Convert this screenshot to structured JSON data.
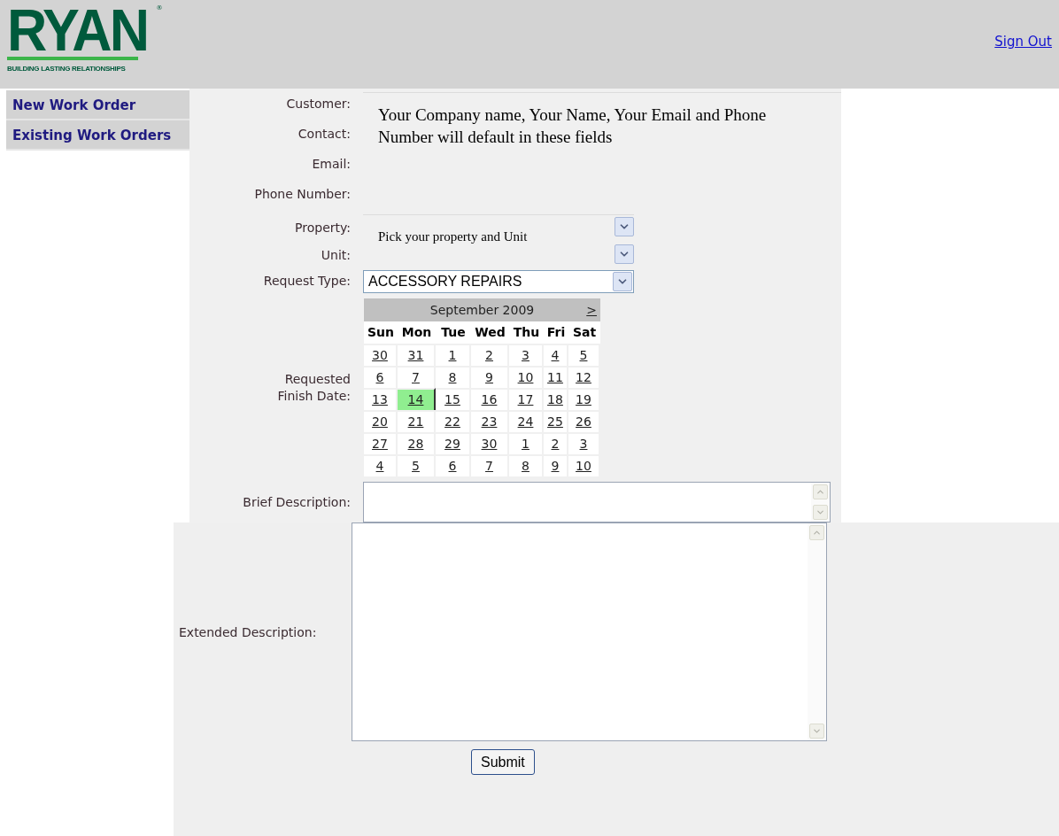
{
  "header": {
    "logo": {
      "wordmark": "RYAN",
      "mark": "®",
      "tagline": "BUILDING LASTING RELATIONSHIPS"
    },
    "sign_out": "Sign Out"
  },
  "sidebar": {
    "items": [
      {
        "label": "New Work Order"
      },
      {
        "label": "Existing Work Orders"
      }
    ]
  },
  "form": {
    "contact_labels": [
      "Customer:",
      "Contact:",
      "Email:",
      "Phone Number:"
    ],
    "contact_note": "Your Company name, Your Name, Your Email and Phone Number will default in these fields",
    "property_label": "Property:",
    "unit_label": "Unit:",
    "property_note": "Pick your property and Unit",
    "request_type": {
      "label": "Request Type:",
      "value": "ACCESSORY REPAIRS"
    },
    "finish_date": {
      "label": "Requested Finish Date:",
      "calendar": {
        "title": "September 2009",
        "next": ">",
        "weekdays": [
          "Sun",
          "Mon",
          "Tue",
          "Wed",
          "Thu",
          "Fri",
          "Sat"
        ],
        "weeks": [
          [
            {
              "day": "30",
              "selected": false
            },
            {
              "day": "31",
              "selected": false
            },
            {
              "day": "1",
              "selected": false
            },
            {
              "day": "2",
              "selected": false
            },
            {
              "day": "3",
              "selected": false
            },
            {
              "day": "4",
              "selected": false
            },
            {
              "day": "5",
              "selected": false
            }
          ],
          [
            {
              "day": "6",
              "selected": false
            },
            {
              "day": "7",
              "selected": false
            },
            {
              "day": "8",
              "selected": false
            },
            {
              "day": "9",
              "selected": false
            },
            {
              "day": "10",
              "selected": false
            },
            {
              "day": "11",
              "selected": false
            },
            {
              "day": "12",
              "selected": false
            }
          ],
          [
            {
              "day": "13",
              "selected": false
            },
            {
              "day": "14",
              "selected": true
            },
            {
              "day": "15",
              "selected": false
            },
            {
              "day": "16",
              "selected": false
            },
            {
              "day": "17",
              "selected": false
            },
            {
              "day": "18",
              "selected": false
            },
            {
              "day": "19",
              "selected": false
            }
          ],
          [
            {
              "day": "20",
              "selected": false
            },
            {
              "day": "21",
              "selected": false
            },
            {
              "day": "22",
              "selected": false
            },
            {
              "day": "23",
              "selected": false
            },
            {
              "day": "24",
              "selected": false
            },
            {
              "day": "25",
              "selected": false
            },
            {
              "day": "26",
              "selected": false
            }
          ],
          [
            {
              "day": "27",
              "selected": false
            },
            {
              "day": "28",
              "selected": false
            },
            {
              "day": "29",
              "selected": false
            },
            {
              "day": "30",
              "selected": false
            },
            {
              "day": "1",
              "selected": false
            },
            {
              "day": "2",
              "selected": false
            },
            {
              "day": "3",
              "selected": false
            }
          ],
          [
            {
              "day": "4",
              "selected": false
            },
            {
              "day": "5",
              "selected": false
            },
            {
              "day": "6",
              "selected": false
            },
            {
              "day": "7",
              "selected": false
            },
            {
              "day": "8",
              "selected": false
            },
            {
              "day": "9",
              "selected": false
            },
            {
              "day": "10",
              "selected": false
            }
          ]
        ]
      }
    },
    "brief_description": {
      "label": "Brief Description:"
    },
    "extended_description": {
      "label": "Extended Description:"
    },
    "submit": "Submit"
  }
}
